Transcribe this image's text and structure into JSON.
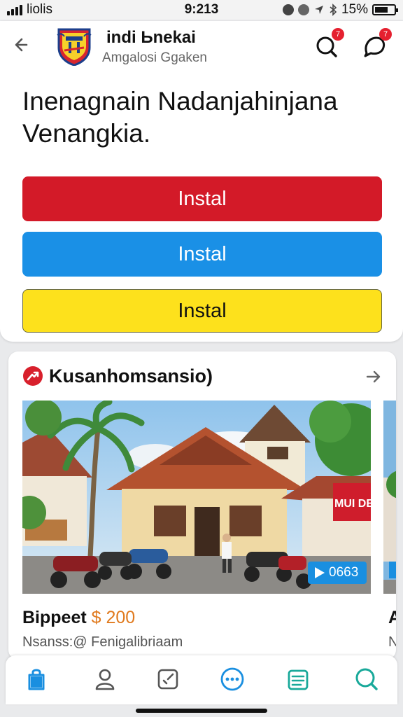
{
  "status_bar": {
    "carrier": "liolis",
    "time": "9:213",
    "battery": "15%"
  },
  "header": {
    "title": "indi Ьnekai",
    "subtitle": "Amgalosi Ggaken",
    "badge_search": "7",
    "badge_chat": "7"
  },
  "main": {
    "headline": "Inenagnain Nadanjahinjana Venangkia.",
    "buttons": [
      {
        "label": "Instal",
        "color": "#d31a28"
      },
      {
        "label": "Instal",
        "color": "#1a90e6"
      },
      {
        "label": "Instal",
        "color": "#fde11c"
      }
    ]
  },
  "section": {
    "title": "Kusanhomsansio)",
    "card": {
      "title": "Bippeet",
      "price": "$ 200",
      "subtitle": "Nsanss:@ Fenigalibriaam",
      "video_label": "0663",
      "sign_text": "MUI DEKI"
    },
    "peek_card": {
      "title": "Al",
      "subtitle": "Ne"
    }
  },
  "bottom_nav": {
    "icons": [
      "bag-icon",
      "person-icon",
      "edit-square-icon",
      "more-icon",
      "list-icon",
      "search-icon"
    ]
  },
  "colors": {
    "accent_red": "#d31a28",
    "accent_blue": "#1a90e6",
    "accent_yellow": "#fde11c",
    "price_orange": "#e07a1e",
    "nav_teal": "#19a99a"
  }
}
